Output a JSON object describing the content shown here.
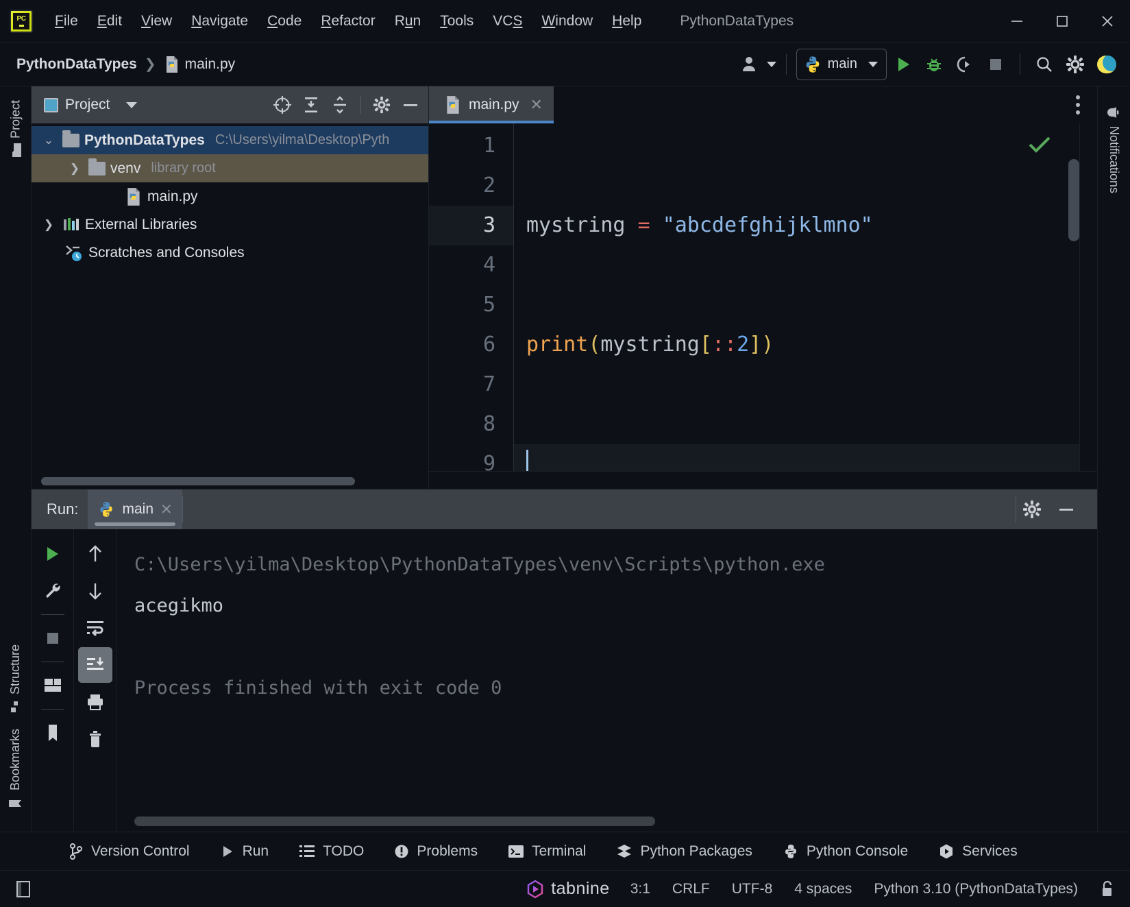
{
  "window": {
    "title": "PythonDataTypes",
    "app_logo": "pycharm-logo",
    "minimize": "–",
    "maximize": "□",
    "close": "✕"
  },
  "menu": {
    "items": [
      {
        "label": "File",
        "mnemonic": "F"
      },
      {
        "label": "Edit",
        "mnemonic": "E"
      },
      {
        "label": "View",
        "mnemonic": "V"
      },
      {
        "label": "Navigate",
        "mnemonic": "N"
      },
      {
        "label": "Code",
        "mnemonic": "C"
      },
      {
        "label": "Refactor",
        "mnemonic": "R"
      },
      {
        "label": "Run",
        "mnemonic": "u"
      },
      {
        "label": "Tools",
        "mnemonic": "T"
      },
      {
        "label": "VCS",
        "mnemonic": "S"
      },
      {
        "label": "Window",
        "mnemonic": "W"
      },
      {
        "label": "Help",
        "mnemonic": "H"
      }
    ]
  },
  "navbar": {
    "project_crumb": "PythonDataTypes",
    "separator": "❯",
    "file_crumb": "main.py",
    "run_config": "main",
    "icons": {
      "account": "account-icon",
      "run": "run-icon",
      "debug": "debug-icon",
      "coverage": "coverage-icon",
      "stop": "stop-icon",
      "search": "search-icon",
      "settings": "gear-icon",
      "updates": "updates-icon"
    }
  },
  "left_stripe": {
    "project": "Project",
    "structure": "Structure",
    "bookmarks": "Bookmarks"
  },
  "right_stripe": {
    "notifications": "Notifications"
  },
  "project_panel": {
    "title": "Project",
    "toolbar": {
      "locate": "locate-icon",
      "expand_all": "expand-all-icon",
      "collapse_all": "collapse-all-icon",
      "settings": "gear-icon",
      "hide": "hide-icon"
    },
    "tree": [
      {
        "name": "PythonDataTypes",
        "sub": "C:\\Users\\yilma\\Desktop\\Pyth",
        "indent": 0,
        "arrow": "expanded",
        "icon": "folder-icon",
        "state": "selected",
        "bold": true
      },
      {
        "name": "venv",
        "sub": "library root",
        "indent": 1,
        "arrow": "collapsed",
        "icon": "folder-icon",
        "state": "highlighted",
        "bold": false
      },
      {
        "name": "main.py",
        "sub": "",
        "indent": 2,
        "arrow": "none",
        "icon": "python-file-icon",
        "state": "normal",
        "bold": false
      },
      {
        "name": "External Libraries",
        "sub": "",
        "indent": 0,
        "arrow": "collapsed",
        "icon": "libraries-icon",
        "state": "normal",
        "bold": false
      },
      {
        "name": "Scratches and Consoles",
        "sub": "",
        "indent": 0,
        "arrow": "none",
        "icon": "scratches-icon",
        "state": "normal",
        "bold": false
      }
    ]
  },
  "editor": {
    "tab": {
      "label": "main.py",
      "icon": "python-file-icon",
      "close": "✕"
    },
    "more_menu": "more-options-icon",
    "inspection_status": "✓",
    "line_numbers": [
      "1",
      "2",
      "3",
      "4",
      "5",
      "6",
      "7",
      "8",
      "9"
    ],
    "current_line": 3,
    "lines": [
      {
        "n": 1,
        "tokens": [
          {
            "t": "mystring ",
            "c": "tok-id"
          },
          {
            "t": "=",
            "c": "tok-op"
          },
          {
            "t": " ",
            "c": "tok-id"
          },
          {
            "t": "\"abcdefghijklmno\"",
            "c": "tok-str"
          }
        ]
      },
      {
        "n": 2,
        "tokens": [
          {
            "t": "print",
            "c": "tok-fn"
          },
          {
            "t": "(",
            "c": "tok-paren"
          },
          {
            "t": "mystring",
            "c": "tok-id"
          },
          {
            "t": "[",
            "c": "tok-brk"
          },
          {
            "t": "::",
            "c": "tok-colon"
          },
          {
            "t": "2",
            "c": "tok-num"
          },
          {
            "t": "]",
            "c": "tok-brk"
          },
          {
            "t": ")",
            "c": "tok-paren"
          }
        ]
      },
      {
        "n": 3,
        "tokens": []
      }
    ],
    "code_text_line1": "mystring = \"abcdefghijklmno\"",
    "code_text_line2": "print(mystring[::2])"
  },
  "run_panel": {
    "label": "Run:",
    "tab": {
      "label": "main",
      "icon": "python-icon",
      "close": "✕"
    },
    "header_tools": {
      "settings": "gear-icon",
      "hide": "hide-icon"
    },
    "toolbar_left": [
      "rerun-icon",
      "wrench-icon",
      "stop-icon",
      "layout-icon"
    ],
    "toolbar_right": [
      "up-arrow-icon",
      "down-arrow-icon",
      "soft-wrap-icon",
      "scroll-to-end-icon",
      "print-icon",
      "trash-icon"
    ],
    "console": [
      {
        "text": "C:\\Users\\yilma\\Desktop\\PythonDataTypes\\venv\\Scripts\\python.exe",
        "style": "dim"
      },
      {
        "text": "acegikmo",
        "style": "out"
      },
      {
        "text": "",
        "style": "dim"
      },
      {
        "text": "Process finished with exit code 0",
        "style": "dim"
      }
    ]
  },
  "toolwindow_bar": {
    "items": [
      {
        "label": "Version Control",
        "icon": "branch-icon"
      },
      {
        "label": "Run",
        "icon": "run-icon"
      },
      {
        "label": "TODO",
        "icon": "todo-icon"
      },
      {
        "label": "Problems",
        "icon": "problems-icon"
      },
      {
        "label": "Terminal",
        "icon": "terminal-icon"
      },
      {
        "label": "Python Packages",
        "icon": "packages-icon"
      },
      {
        "label": "Python Console",
        "icon": "python-icon"
      },
      {
        "label": "Services",
        "icon": "services-icon"
      }
    ]
  },
  "status_bar": {
    "layout_icon": "layout-icon",
    "tabnine": "tabnine",
    "caret_position": "3:1",
    "line_separator": "CRLF",
    "encoding": "UTF-8",
    "indent": "4 spaces",
    "interpreter": "Python 3.10 (PythonDataTypes)",
    "lock_icon": "unlocked-icon"
  },
  "colors": {
    "background": "#0d1117",
    "panel_header": "#3c4148",
    "selection_blue": "#1d3a5f",
    "highlight_olive": "#5c5647",
    "accent_blue": "#4a88c7",
    "run_green": "#4caf50",
    "string_blue": "#8fb9e8",
    "function_orange": "#f0a350",
    "keyword_orange": "#e0c060"
  }
}
